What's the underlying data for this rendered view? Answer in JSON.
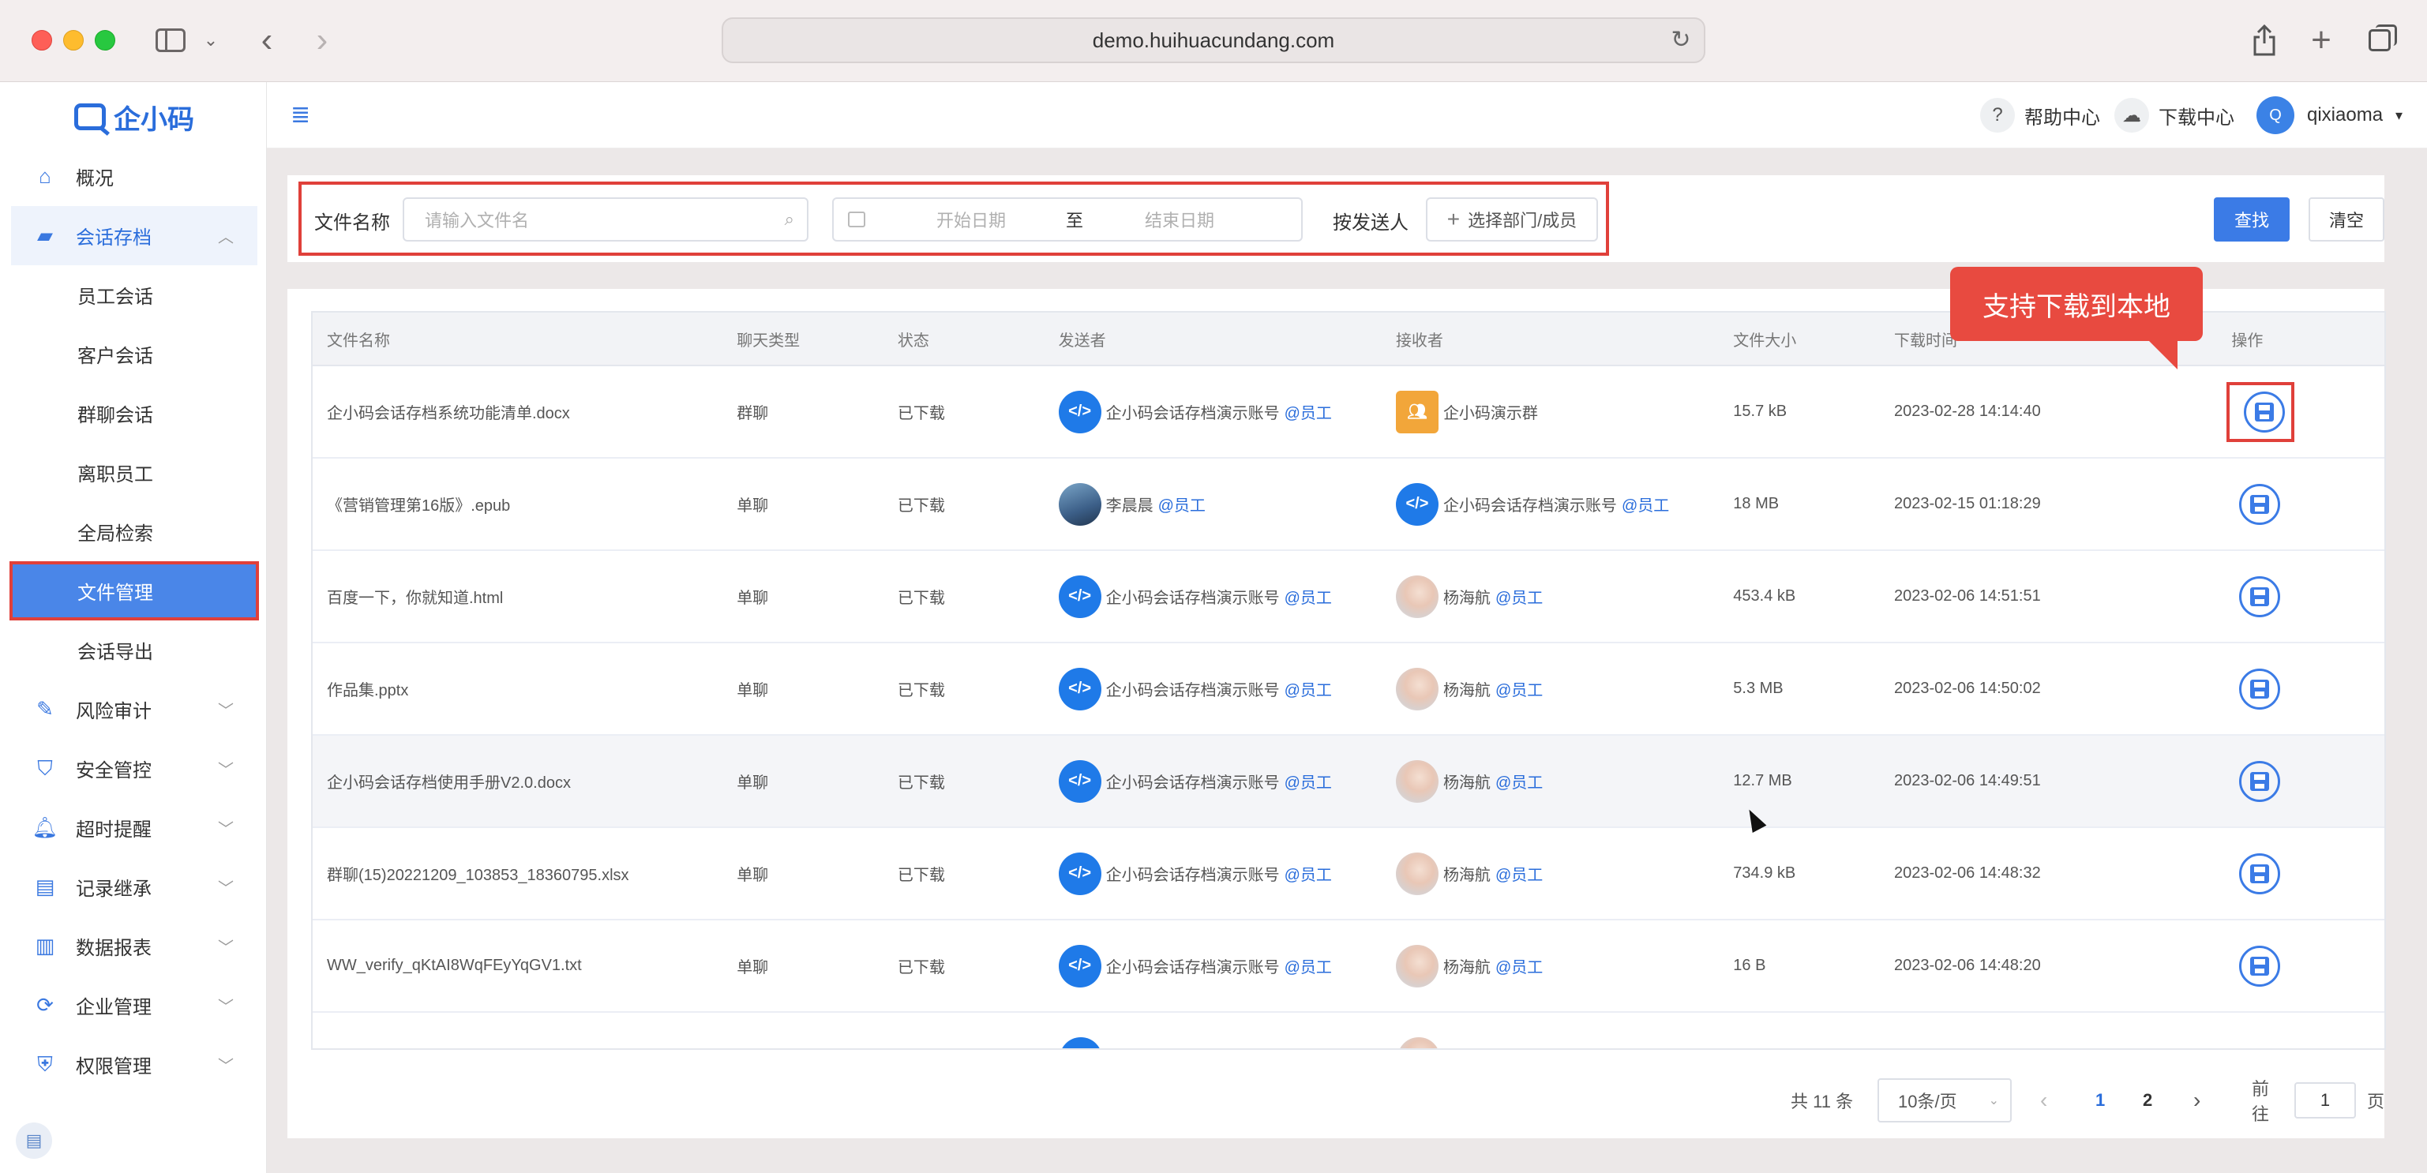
{
  "browser": {
    "url": "demo.huihuacundang.com"
  },
  "logo": {
    "text": "企小码"
  },
  "sidebar": {
    "items": [
      {
        "label": "概况",
        "icon": "home-icon"
      },
      {
        "label": "会话存档",
        "icon": "folder-icon",
        "expanded": true,
        "children": [
          "员工会话",
          "客户会话",
          "群聊会话",
          "离职员工",
          "全局检索",
          "文件管理",
          "会话导出"
        ],
        "selected": "文件管理"
      },
      {
        "label": "风险审计",
        "icon": "audit-icon"
      },
      {
        "label": "安全管控",
        "icon": "shield-icon"
      },
      {
        "label": "超时提醒",
        "icon": "bell-icon"
      },
      {
        "label": "记录继承",
        "icon": "inherit-icon"
      },
      {
        "label": "数据报表",
        "icon": "chart-icon"
      },
      {
        "label": "企业管理",
        "icon": "refresh-icon"
      },
      {
        "label": "权限管理",
        "icon": "lock-icon"
      }
    ]
  },
  "header": {
    "help_label": "帮助中心",
    "download_label": "下载中心",
    "user_initial": "Q",
    "user_name": "qixiaoma"
  },
  "filters": {
    "file_name_label": "文件名称",
    "file_name_placeholder": "请输入文件名",
    "start_date_placeholder": "开始日期",
    "date_separator": "至",
    "end_date_placeholder": "结束日期",
    "sender_label": "按发送人",
    "sender_button": "选择部门/成员",
    "search_button": "查找",
    "clear_button": "清空"
  },
  "callout": "支持下载到本地",
  "table": {
    "columns": [
      "文件名称",
      "聊天类型",
      "状态",
      "发送者",
      "接收者",
      "文件大小",
      "下载时间",
      "操作"
    ],
    "rows": [
      {
        "name": "企小码会话存档系统功能清单.docx",
        "type": "群聊",
        "status": "已下载",
        "sender": "企小码会话存档演示账号",
        "sender_tag": "@员工",
        "sender_avatar": "code",
        "receiver": "企小码演示群",
        "receiver_tag": "",
        "receiver_avatar": "group",
        "size": "15.7 kB",
        "time": "2023-02-28 14:14:40"
      },
      {
        "name": "《营销管理第16版》.epub",
        "type": "单聊",
        "status": "已下载",
        "sender": "李晨晨",
        "sender_tag": "@员工",
        "sender_avatar": "photo",
        "receiver": "企小码会话存档演示账号",
        "receiver_tag": "@员工",
        "receiver_avatar": "code",
        "size": "18 MB",
        "time": "2023-02-15 01:18:29"
      },
      {
        "name": "百度一下，你就知道.html",
        "type": "单聊",
        "status": "已下载",
        "sender": "企小码会话存档演示账号",
        "sender_tag": "@员工",
        "sender_avatar": "code",
        "receiver": "杨海航",
        "receiver_tag": "@员工",
        "receiver_avatar": "girl",
        "size": "453.4 kB",
        "time": "2023-02-06 14:51:51"
      },
      {
        "name": "作品集.pptx",
        "type": "单聊",
        "status": "已下载",
        "sender": "企小码会话存档演示账号",
        "sender_tag": "@员工",
        "sender_avatar": "code",
        "receiver": "杨海航",
        "receiver_tag": "@员工",
        "receiver_avatar": "girl",
        "size": "5.3 MB",
        "time": "2023-02-06 14:50:02"
      },
      {
        "name": "企小码会话存档使用手册V2.0.docx",
        "type": "单聊",
        "status": "已下载",
        "sender": "企小码会话存档演示账号",
        "sender_tag": "@员工",
        "sender_avatar": "code",
        "receiver": "杨海航",
        "receiver_tag": "@员工",
        "receiver_avatar": "girl",
        "size": "12.7 MB",
        "time": "2023-02-06 14:49:51"
      },
      {
        "name": "群聊(15)20221209_103853_18360795.xlsx",
        "type": "单聊",
        "status": "已下载",
        "sender": "企小码会话存档演示账号",
        "sender_tag": "@员工",
        "sender_avatar": "code",
        "receiver": "杨海航",
        "receiver_tag": "@员工",
        "receiver_avatar": "girl",
        "size": "734.9 kB",
        "time": "2023-02-06 14:48:32"
      },
      {
        "name": "WW_verify_qKtAI8WqFEyYqGV1.txt",
        "type": "单聊",
        "status": "已下载",
        "sender": "企小码会话存档演示账号",
        "sender_tag": "@员工",
        "sender_avatar": "code",
        "receiver": "杨海航",
        "receiver_tag": "@员工",
        "receiver_avatar": "girl",
        "size": "16 B",
        "time": "2023-02-06 14:48:20"
      }
    ]
  },
  "pagination": {
    "total": "共 11 条",
    "page_size": "10条/页",
    "pages": [
      "1",
      "2"
    ],
    "current_page": "1",
    "goto_label": "前往",
    "goto_value": "1",
    "goto_suffix": "页"
  }
}
